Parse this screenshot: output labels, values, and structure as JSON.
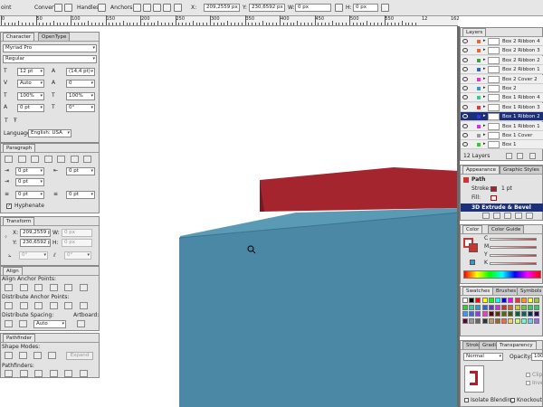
{
  "control_bar": {
    "point_label": "oint",
    "convert_label": "Convert:",
    "handles_label": "Handles:",
    "anchors_label": "Anchors:",
    "x_label": "X:",
    "x_value": "209,2559 px",
    "y_label": "Y:",
    "y_value": "230,6592 px",
    "w_label": "W:",
    "w_value": "0 px",
    "h_label": "H:",
    "h_value": "0 px"
  },
  "ruler": {
    "labels": [
      "0",
      "50",
      "100",
      "150",
      "200",
      "250",
      "300",
      "350",
      "400",
      "450",
      "500",
      "550"
    ],
    "right_labels": [
      "12",
      "162"
    ]
  },
  "character": {
    "tab_character": "Character",
    "tab_opentype": "OpenType",
    "font": "Myriad Pro",
    "style": "Regular",
    "size": "12 pt",
    "leading": "(14,4 pt)",
    "kerning": "Auto",
    "tracking": "0",
    "vscale": "100%",
    "hscale": "100%",
    "baseline": "0 pt",
    "rotation": "0°",
    "language_label": "Language:",
    "language": "English: USA"
  },
  "paragraph": {
    "title": "Paragraph",
    "left_indent": "0 pt",
    "right_indent": "0 pt",
    "first_indent": "0 pt",
    "space_before": "0 pt",
    "space_after": "0 pt",
    "hyphenate_label": "Hyphenate"
  },
  "transform": {
    "title": "Transform",
    "x_label": "X:",
    "x_value": "209,2559 px",
    "w_label": "W:",
    "w_value": "0 px",
    "y_label": "Y:",
    "y_value": "230,6592 px",
    "h_label": "H:",
    "h_value": "0 px",
    "rot_value": "0°",
    "shear_value": "0°"
  },
  "align": {
    "title": "Align",
    "anchor_points": "Align Anchor Points:",
    "distribute_points": "Distribute Anchor Points:",
    "distribute_spacing": "Distribute Spacing:",
    "artboard": "Artboard:",
    "spacing_value": "Auto"
  },
  "pathfinder": {
    "title": "Pathfinder",
    "shape_modes": "Shape Modes:",
    "expand": "Expand",
    "pathfinders": "Pathfinders:"
  },
  "layers": {
    "title": "Layers",
    "items": [
      {
        "name": "Box 2 Ribbon 4",
        "color": "#e63"
      },
      {
        "name": "Box 2 Ribbon 3",
        "color": "#e63"
      },
      {
        "name": "Box 2 Ribbon 2",
        "color": "#3a3"
      },
      {
        "name": "Box 2 Ribbon 1",
        "color": "#36c"
      },
      {
        "name": "Box 2 Cover 2",
        "color": "#e3c"
      },
      {
        "name": "Box 2",
        "color": "#39c"
      },
      {
        "name": "Box 1 Ribbon 4",
        "color": "#3c9"
      },
      {
        "name": "Box 1 Ribbon 3",
        "color": "#e33"
      },
      {
        "name": "Box 1 Ribbon 2",
        "color": "#33e"
      },
      {
        "name": "Box 1 Ribbon 1",
        "color": "#c3e"
      },
      {
        "name": "Box 1 Cover",
        "color": "#999"
      },
      {
        "name": "Box 1",
        "color": "#3c3"
      }
    ],
    "selected_index": 8,
    "count": "12 Layers"
  },
  "appearance": {
    "tab_appearance": "Appearance",
    "tab_graphic_styles": "Graphic Styles",
    "path_label": "Path",
    "stroke_label": "Stroke:",
    "stroke_value": "1 pt",
    "stroke_color": "#b01e2a",
    "fill_label": "Fill:",
    "effect_label": "3D Extrude & Bevel"
  },
  "color": {
    "tab_color": "Color",
    "tab_guide": "Color Guide",
    "channels": [
      "C",
      "M",
      "Y",
      "K"
    ]
  },
  "swatches": {
    "tab_swatches": "Swatches",
    "tab_brushes": "Brushes",
    "tab_symbols": "Symbols",
    "colors": [
      "#ffffff",
      "#000000",
      "#ff0000",
      "#ffff00",
      "#00ff00",
      "#00ffff",
      "#0000ff",
      "#ff00ff",
      "#e32",
      "#f90",
      "#ff3",
      "#9c3",
      "#3c3",
      "#3c9",
      "#39c",
      "#36c",
      "#63c",
      "#c3c",
      "#c33",
      "#c63",
      "#cc3",
      "#6c3",
      "#3c6",
      "#3c6",
      "#39f",
      "#36f",
      "#93f",
      "#f3c",
      "#600",
      "#630",
      "#660",
      "#360",
      "#063",
      "#066",
      "#036",
      "#306",
      "#603",
      "#999",
      "#666",
      "#333",
      "#c96",
      "#963",
      "#f63",
      "#fc6",
      "#cf6",
      "#6fc",
      "#6cf",
      "#96f"
    ]
  },
  "transparency": {
    "tab_stroke": "Stroke",
    "tab_gradient": "Gradi",
    "tab_transparency": "Transparency",
    "blend_mode": "Normal",
    "opacity_label": "Opacity:",
    "opacity_value": "100",
    "clip_label": "Clip",
    "invert_label": "Invert",
    "isolate_label": "Isolate Blending",
    "knockout_label": "Knockout Gr"
  },
  "canvas": {
    "box_front": "#4a88a5",
    "box_top": "#5b9ab5",
    "ribbon": "#a5252e"
  }
}
